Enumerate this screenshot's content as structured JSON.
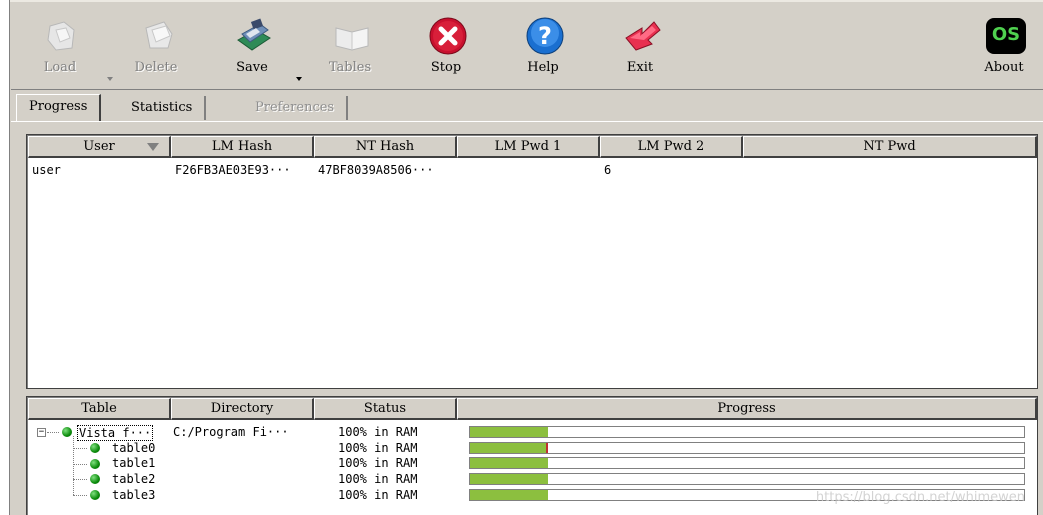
{
  "toolbar": {
    "load": "Load",
    "delete": "Delete",
    "save": "Save",
    "tables": "Tables",
    "stop": "Stop",
    "help": "Help",
    "exit": "Exit",
    "about": "About",
    "about_badge": "OS"
  },
  "tabs": {
    "progress": "Progress",
    "statistics": "Statistics",
    "preferences": "Preferences"
  },
  "hash_grid": {
    "columns": [
      "User",
      "LM Hash",
      "NT Hash",
      "LM Pwd 1",
      "LM Pwd 2",
      "NT Pwd"
    ],
    "rows": [
      {
        "user": "user",
        "lm_hash": "F26FB3AE03E93···",
        "nt_hash": "47BF8039A8506···",
        "lm_pwd1": "",
        "lm_pwd2": "6",
        "nt_pwd": ""
      }
    ]
  },
  "table_grid": {
    "columns": [
      "Table",
      "Directory",
      "Status",
      "Progress"
    ],
    "root": {
      "name": "Vista f···",
      "directory": "C:/Program Fi···",
      "status": "100% in RAM",
      "progress": 0.14
    },
    "children": [
      {
        "name": "table0",
        "status": "100% in RAM",
        "progress": 0.14
      },
      {
        "name": "table1",
        "status": "100% in RAM",
        "progress": 0.14
      },
      {
        "name": "table2",
        "status": "100% in RAM",
        "progress": 0.14
      },
      {
        "name": "table3",
        "status": "100% in RAM",
        "progress": 0.14
      }
    ]
  },
  "colors": {
    "progress_fill": "#8cbf3f",
    "window_bg": "#d4d0c8"
  },
  "watermark": "https://blog.csdn.net/whimewen"
}
